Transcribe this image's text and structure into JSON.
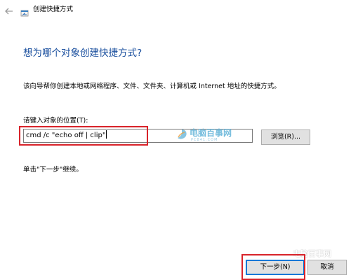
{
  "header": {
    "back_icon": "back-arrow-icon",
    "wizard_icon": "shortcut-wizard-icon",
    "title": "创建快捷方式"
  },
  "main": {
    "heading": "想为哪个对象创建快捷方式?",
    "description": "该向导帮你创建本地或网络程序、文件、文件夹、计算机或 Internet 地址的快捷方式。",
    "location_label": "请键入对象的位置(T):",
    "location_value": "cmd /c \"echo off | clip\"",
    "browse_label": "浏览(R)...",
    "continue_hint": "单击\"下一步\"继续。"
  },
  "footer": {
    "next_label": "下一步(N)",
    "cancel_label": "取消"
  },
  "watermarks": {
    "center_text": "电脑百事网",
    "center_sub": "PC841.COM",
    "corner_text": "电脑百事网"
  },
  "colors": {
    "heading": "#1a4f9e",
    "highlight": "#d8232a",
    "primary_button_border": "#0078d7",
    "watermark": "#5fb2d8"
  }
}
